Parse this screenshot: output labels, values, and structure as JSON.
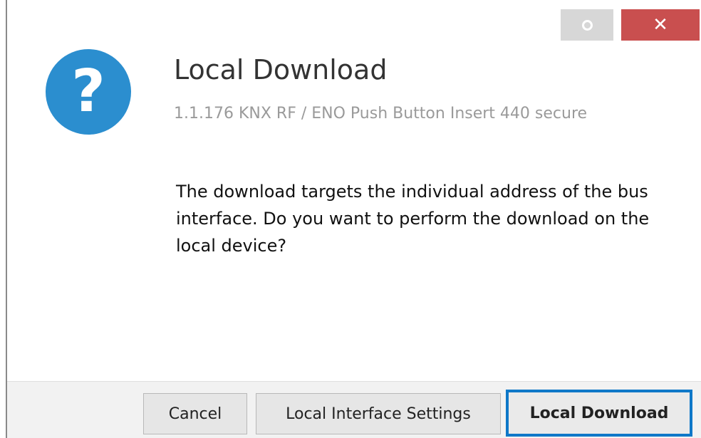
{
  "window": {
    "options_icon": "ring-icon",
    "close_glyph": "✕"
  },
  "dialog": {
    "icon_glyph": "?",
    "icon_color": "#2b8ecf",
    "title": "Local Download",
    "subtitle": "1.1.176 KNX RF / ENO Push Button Insert 440 secure",
    "message": "The download targets the individual address of the bus interface. Do you want to perform the download on the local device?"
  },
  "buttons": {
    "cancel_label": "Cancel",
    "settings_label": "Local Interface Settings",
    "download_label": "Local Download",
    "focus_color": "#0f78c8"
  }
}
